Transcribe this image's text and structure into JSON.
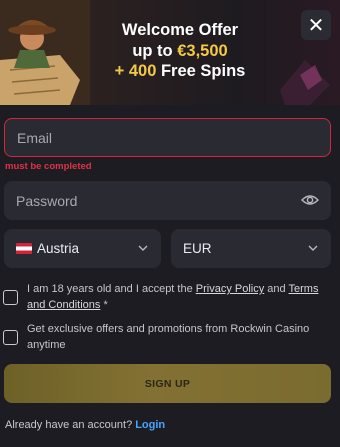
{
  "offer": {
    "line1": "Welcome Offer",
    "line2_prefix": "up to ",
    "line2_amount": "€3,500",
    "line3_prefix": "+ 400",
    "line3_suffix": " Free Spins"
  },
  "close": {
    "icon": "close-icon",
    "glyph": "✕"
  },
  "email": {
    "placeholder": "Email",
    "value": "",
    "error": "must be completed"
  },
  "password": {
    "placeholder": "Password",
    "value": "",
    "icon": "eye-icon"
  },
  "country": {
    "value": "Austria",
    "icon": "austria-flag-icon"
  },
  "currency": {
    "value": "EUR"
  },
  "terms": {
    "text_before": "I am 18 years old and I accept the ",
    "privacy_link": "Privacy Policy",
    "text_mid": " and ",
    "terms_link": "Terms and Conditions",
    "text_after": " *",
    "checked": false
  },
  "promo": {
    "text": "Get exclusive offers and promotions from Rockwin Casino anytime",
    "checked": false
  },
  "signup": {
    "label": "SIGN UP"
  },
  "login": {
    "prompt": "Already have an account?",
    "link": "Login"
  },
  "colors": {
    "background": "#1c1c22",
    "field": "#2a2a32",
    "error": "#e03246",
    "gold": "#f4c945",
    "link": "#4aa3ff"
  }
}
